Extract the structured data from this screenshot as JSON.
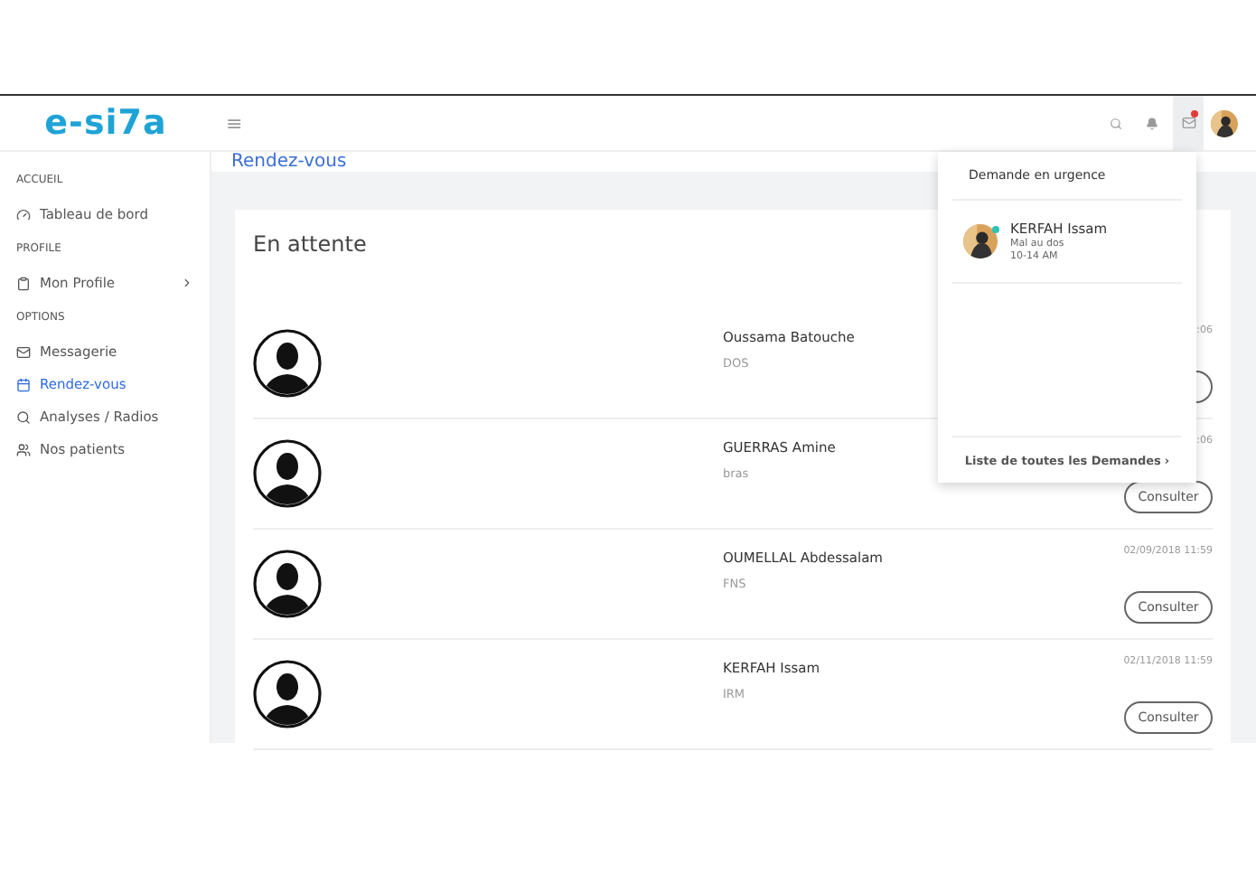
{
  "header": {
    "logo": "e-si7a",
    "menu_icon": "≡",
    "mail_unread": true
  },
  "sidebar": [
    {
      "kind": "section",
      "label": "ACCUEIL"
    },
    {
      "kind": "item",
      "label": "Tableau de bord",
      "selected": false
    },
    {
      "kind": "section",
      "label": "PROFILE"
    },
    {
      "kind": "item",
      "label": "Mon Profile",
      "selected": false,
      "expandable": true
    },
    {
      "kind": "section",
      "label": "OPTIONS"
    },
    {
      "kind": "item",
      "label": "Messagerie",
      "selected": false
    },
    {
      "kind": "item",
      "label": "Rendez-vous",
      "selected": true
    },
    {
      "kind": "item",
      "label": "Analyses / Radios",
      "selected": false
    },
    {
      "kind": "item",
      "label": "Nos patients",
      "selected": false
    }
  ],
  "breadcrumb": "Rendez-vous",
  "card": {
    "title": "En attente",
    "rows": [
      {
        "name": "Oussama Batouche",
        "subject": "DOS",
        "date": ":06"
      },
      {
        "name": "GUERRAS Amine",
        "subject": "bras",
        "date": ":06",
        "button": "Consulter"
      },
      {
        "name": "OUMELLAL Abdessalam",
        "subject": "FNS",
        "date": "02/09/2018 11:59",
        "button": "Consulter"
      },
      {
        "name": "KERFAH Issam",
        "subject": "IRM",
        "date": "02/11/2018 11:59",
        "button": "Consulter"
      }
    ]
  },
  "dropdown": {
    "title": "Demande en urgence",
    "items": [
      {
        "name": "KERFAH Issam",
        "subject": "Mal au dos",
        "time": "10-14 AM",
        "online": true
      }
    ],
    "footer": "Liste de toutes les Demandes",
    "footer_arrow": "›"
  }
}
